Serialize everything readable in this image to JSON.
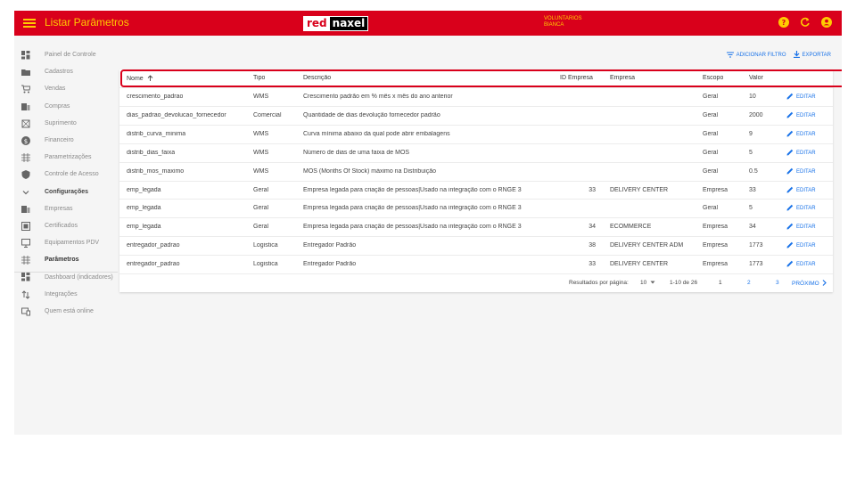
{
  "app": {
    "title": "Listar Parâmetros",
    "logo_red": "red",
    "logo_naxel": "naxel",
    "user_line1": "VOLUNTARIOS",
    "user_line2": "BIANCA",
    "accent": "#d9001b",
    "title_color": "#ffcc00",
    "top_icons": [
      "help-icon",
      "refresh-icon",
      "user-account-icon"
    ]
  },
  "sidebar": {
    "items": [
      {
        "label": "Painel de Controle",
        "icon": "dashboard-icon"
      },
      {
        "label": "Cadastros",
        "icon": "folder-icon"
      },
      {
        "label": "Vendas",
        "icon": "cart-icon"
      },
      {
        "label": "Compras",
        "icon": "purchases-icon"
      },
      {
        "label": "Suprimento",
        "icon": "supply-icon"
      },
      {
        "label": "Financeiro",
        "icon": "money-icon"
      },
      {
        "label": "Parametrizações",
        "icon": "settings-grid-icon"
      },
      {
        "label": "Controle de Acesso",
        "icon": "shield-icon"
      },
      {
        "label": "Configurações",
        "icon": "chevron-down-icon"
      },
      {
        "label": "Empresas",
        "icon": "company-icon"
      },
      {
        "label": "Certificados",
        "icon": "certificate-icon"
      },
      {
        "label": "Equipamentos PDV",
        "icon": "monitor-icon"
      },
      {
        "label": "Parâmetros",
        "icon": "parameters-icon"
      },
      {
        "label": "Dashboard (indicadores)",
        "icon": "dashboard-icon"
      },
      {
        "label": "Integrações",
        "icon": "sync-icon"
      },
      {
        "label": "Quem está online",
        "icon": "devices-icon"
      }
    ]
  },
  "toolbar": {
    "filter_label": "ADICIONAR FILTRO",
    "export_label": "EXPORTAR"
  },
  "table": {
    "columns": {
      "nome": "Nome",
      "tipo": "Tipo",
      "descricao": "Descrição",
      "id_empresa": "ID Empresa",
      "empresa": "Empresa",
      "escopo": "Escopo",
      "valor": "Valor"
    },
    "edit_label": "EDITAR",
    "rows": [
      {
        "nome": "crescimento_padrao",
        "tipo": "WMS",
        "descricao": "Crescimento padrão em % mês x mês do ano anterior",
        "id_empresa": "",
        "empresa": "",
        "escopo": "Geral",
        "valor": "10"
      },
      {
        "nome": "dias_padrao_devolucao_fornecedor",
        "tipo": "Comercial",
        "descricao": "Quantidade de dias devolução fornecedor padrão",
        "id_empresa": "",
        "empresa": "",
        "escopo": "Geral",
        "valor": "2000"
      },
      {
        "nome": "distrib_curva_minima",
        "tipo": "WMS",
        "descricao": "Curva mínima abaixo da qual pode abrir embalagens",
        "id_empresa": "",
        "empresa": "",
        "escopo": "Geral",
        "valor": "9"
      },
      {
        "nome": "distrib_dias_faixa",
        "tipo": "WMS",
        "descricao": "Número de dias de uma faixa de MOS",
        "id_empresa": "",
        "empresa": "",
        "escopo": "Geral",
        "valor": "5"
      },
      {
        "nome": "distrib_mos_maximo",
        "tipo": "WMS",
        "descricao": "MOS (Months Of Stock) máximo na Distribuição",
        "id_empresa": "",
        "empresa": "",
        "escopo": "Geral",
        "valor": "0.5"
      },
      {
        "nome": "emp_legada",
        "tipo": "Geral",
        "descricao": "Empresa legada para criação de pessoas|Usado na integração com o RNGE 3",
        "id_empresa": "33",
        "empresa": "DELIVERY CENTER",
        "escopo": "Empresa",
        "valor": "33"
      },
      {
        "nome": "emp_legada",
        "tipo": "Geral",
        "descricao": "Empresa legada para criação de pessoas|Usado na integração com o RNGE 3",
        "id_empresa": "",
        "empresa": "",
        "escopo": "Geral",
        "valor": "5"
      },
      {
        "nome": "emp_legada",
        "tipo": "Geral",
        "descricao": "Empresa legada para criação de pessoas|Usado na integração com o RNGE 3",
        "id_empresa": "34",
        "empresa": "ECOMMERCE",
        "escopo": "Empresa",
        "valor": "34"
      },
      {
        "nome": "entregador_padrao",
        "tipo": "Logistica",
        "descricao": "Entregador Padrão",
        "id_empresa": "38",
        "empresa": "DELIVERY CENTER ADM",
        "escopo": "Empresa",
        "valor": "1773"
      },
      {
        "nome": "entregador_padrao",
        "tipo": "Logistica",
        "descricao": "Entregador Padrão",
        "id_empresa": "33",
        "empresa": "DELIVERY CENTER",
        "escopo": "Empresa",
        "valor": "1773"
      }
    ]
  },
  "pagination": {
    "rows_label": "Resultados por página:",
    "rows_per_page": "10",
    "range": "1-10 de 26",
    "pages": [
      "1",
      "2",
      "3"
    ],
    "next_label": "PRÓXIMO"
  }
}
